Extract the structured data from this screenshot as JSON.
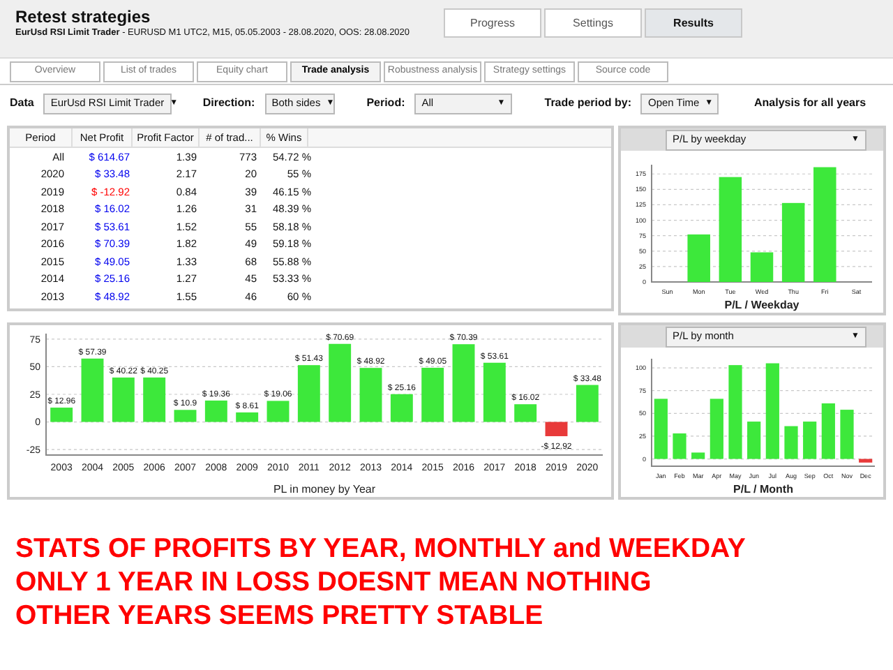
{
  "header": {
    "title": "Retest strategies",
    "subtitle_bold": "EurUsd RSI Limit Trader",
    "subtitle_rest": " - EURUSD  M1  UTC2, M15, 05.05.2003 - 28.08.2020, OOS: 28.08.2020"
  },
  "top_buttons": [
    {
      "label": "Progress",
      "selected": false
    },
    {
      "label": "Settings",
      "selected": false
    },
    {
      "label": "Results",
      "selected": true
    }
  ],
  "tabs": [
    {
      "label": "Overview",
      "selected": false
    },
    {
      "label": "List of trades",
      "selected": false
    },
    {
      "label": "Equity chart",
      "selected": false
    },
    {
      "label": "Trade analysis",
      "selected": true
    },
    {
      "label": "Robustness analysis",
      "selected": false
    },
    {
      "label": "Strategy settings",
      "selected": false
    },
    {
      "label": "Source code",
      "selected": false
    }
  ],
  "filters": [
    {
      "label": "Data",
      "value": "EurUsd RSI Limit Trader",
      "caret": "▼"
    },
    {
      "label": "Direction:",
      "value": "Both sides",
      "caret": "▼"
    },
    {
      "label": "Period:",
      "value": "All",
      "caret": "▼"
    },
    {
      "label": "Trade period by:",
      "value": "Open Time",
      "caret": "▼"
    }
  ],
  "analysis_label": "Analysis for all years",
  "table": {
    "columns": [
      "Period",
      "Net Profit",
      "Profit Factor",
      "# of trad...",
      "% Wins"
    ],
    "rows": [
      {
        "period": "All",
        "net_profit": "$ 614.67",
        "negative": false,
        "profit_factor": "1.39",
        "trades": "773",
        "wins": "54.72 %"
      },
      {
        "period": "2020",
        "net_profit": "$ 33.48",
        "negative": false,
        "profit_factor": "2.17",
        "trades": "20",
        "wins": "55 %"
      },
      {
        "period": "2019",
        "net_profit": "$ -12.92",
        "negative": true,
        "profit_factor": "0.84",
        "trades": "39",
        "wins": "46.15 %"
      },
      {
        "period": "2018",
        "net_profit": "$ 16.02",
        "negative": false,
        "profit_factor": "1.26",
        "trades": "31",
        "wins": "48.39 %"
      },
      {
        "period": "2017",
        "net_profit": "$ 53.61",
        "negative": false,
        "profit_factor": "1.52",
        "trades": "55",
        "wins": "58.18 %"
      },
      {
        "period": "2016",
        "net_profit": "$ 70.39",
        "negative": false,
        "profit_factor": "1.82",
        "trades": "49",
        "wins": "59.18 %"
      },
      {
        "period": "2015",
        "net_profit": "$ 49.05",
        "negative": false,
        "profit_factor": "1.33",
        "trades": "68",
        "wins": "55.88 %"
      },
      {
        "period": "2014",
        "net_profit": "$ 25.16",
        "negative": false,
        "profit_factor": "1.27",
        "trades": "45",
        "wins": "53.33 %"
      },
      {
        "period": "2013",
        "net_profit": "$ 48.92",
        "negative": false,
        "profit_factor": "1.55",
        "trades": "46",
        "wins": "60 %"
      }
    ]
  },
  "weekday_panel": {
    "select": "P/L by weekday",
    "caret": "▼",
    "chart_data": {
      "type": "bar",
      "grid": true,
      "xlabel": "P/L / Weekday",
      "categories": [
        "Sun",
        "Mon",
        "Tue",
        "Wed",
        "Thu",
        "Fri",
        "Sat"
      ],
      "series": [
        {
          "color": "#3de83b",
          "values": [
            0,
            77,
            170,
            48,
            128,
            186,
            0
          ]
        }
      ],
      "ylim": [
        0,
        190
      ],
      "yticks": [
        0,
        25,
        50,
        75,
        100,
        125,
        150,
        175
      ]
    }
  },
  "year_panel": {
    "chart_data": {
      "type": "bar",
      "grid": true,
      "xlabel": "PL in money by Year",
      "categories": [
        "2003",
        "2004",
        "2005",
        "2006",
        "2007",
        "2008",
        "2009",
        "2010",
        "2011",
        "2012",
        "2013",
        "2014",
        "2015",
        "2016",
        "2017",
        "2018",
        "2019",
        "2020"
      ],
      "series": [
        {
          "color": "#3de83b",
          "values": [
            12.96,
            57.39,
            40.22,
            40.25,
            10.9,
            19.36,
            8.61,
            19.06,
            51.43,
            70.69,
            48.92,
            25.16,
            49.05,
            70.39,
            53.61,
            16.02,
            null,
            33.48
          ]
        },
        {
          "color": "#e83a3a",
          "values": [
            null,
            null,
            null,
            null,
            null,
            null,
            null,
            null,
            null,
            null,
            null,
            null,
            null,
            null,
            null,
            null,
            -12.92,
            null
          ]
        }
      ],
      "value_labels": [
        "$ 12.96",
        "$ 57.39",
        "$ 40.22",
        "$ 40.25",
        "$ 10.9",
        "$ 19.36",
        "$ 8.61",
        "$ 19.06",
        "$ 51.43",
        "$ 70.69",
        "$ 48.92",
        "$ 25.16",
        "$ 49.05",
        "$ 70.39",
        "$ 53.61",
        "$ 16.02",
        "-$ 12.92",
        "$ 33.48"
      ],
      "ylim": [
        -30,
        80
      ],
      "yticks": [
        -25,
        0,
        25,
        50,
        75
      ]
    }
  },
  "month_panel": {
    "select": "P/L by month",
    "caret": "▼",
    "chart_data": {
      "type": "bar",
      "grid": true,
      "xlabel": "P/L / Month",
      "categories": [
        "Jan",
        "Feb",
        "Mar",
        "Apr",
        "May",
        "Jun",
        "Jul",
        "Aug",
        "Sep",
        "Oct",
        "Nov",
        "Dec"
      ],
      "series": [
        {
          "color": "#3de83b",
          "values": [
            66,
            28,
            7,
            66,
            103,
            41,
            105,
            36,
            41,
            61,
            54,
            null
          ]
        },
        {
          "color": "#e83a3a",
          "values": [
            null,
            null,
            null,
            null,
            null,
            null,
            null,
            null,
            null,
            null,
            null,
            -4
          ]
        }
      ],
      "ylim": [
        -8,
        110
      ],
      "yticks": [
        0,
        25,
        50,
        75,
        100
      ]
    }
  },
  "note_lines": [
    "STATS OF PROFITS BY YEAR, MONTHLY and WEEKDAY",
    "ONLY 1 YEAR IN LOSS DOESNT MEAN NOTHING",
    "OTHER YEARS SEEMS PRETTY STABLE"
  ]
}
